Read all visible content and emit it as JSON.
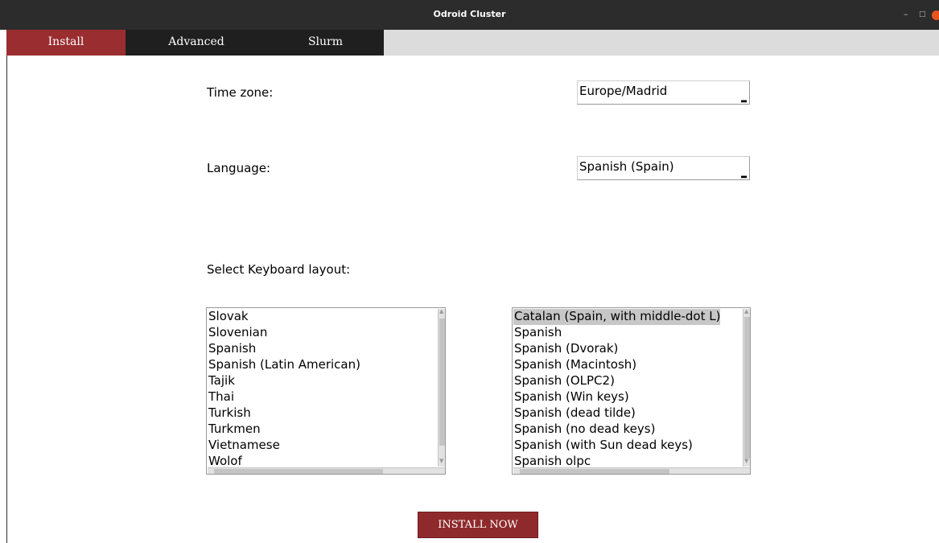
{
  "window": {
    "title": "Odroid Cluster"
  },
  "tabs": [
    {
      "label": "Install",
      "active": true
    },
    {
      "label": "Advanced",
      "active": false
    },
    {
      "label": "Slurm",
      "active": false
    }
  ],
  "install": {
    "timezone": {
      "label": "Time zone:",
      "value": "Europe/Madrid"
    },
    "language": {
      "label": "Language:",
      "value": "Spanish (Spain)"
    },
    "keyboard": {
      "label": "Select Keyboard layout:",
      "layouts": [
        "Slovak",
        "Slovenian",
        "Spanish",
        "Spanish (Latin American)",
        "Tajik",
        "Thai",
        "Turkish",
        "Turkmen",
        "Vietnamese",
        "Wolof"
      ],
      "variants": [
        "Catalan (Spain, with middle-dot L)",
        "Spanish",
        "Spanish (Dvorak)",
        "Spanish (Macintosh)",
        "Spanish (OLPC2)",
        "Spanish (Win keys)",
        "Spanish (dead tilde)",
        "Spanish (no dead keys)",
        "Spanish (with Sun dead keys)",
        "Spanish olpc"
      ],
      "selected_variant": "Catalan (Spain, with middle-dot L)"
    },
    "install_button": "INSTALL NOW"
  },
  "colors": {
    "accent": "#9a2d30",
    "titlebar": "#2c2c2c",
    "tab_inactive": "#1f1f1f"
  }
}
